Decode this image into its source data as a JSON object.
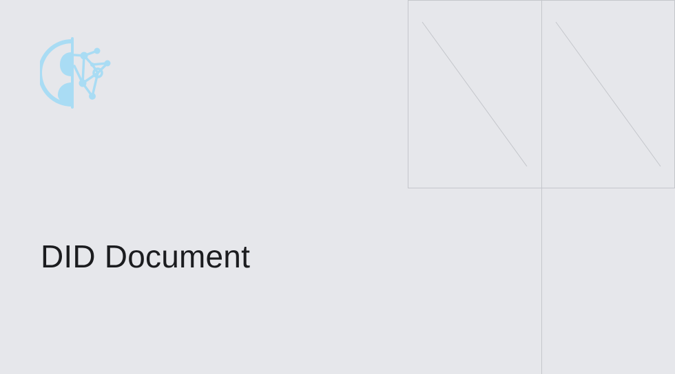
{
  "page": {
    "title": "DID Document"
  },
  "logo": {
    "icon": "did-network-brain-icon",
    "color": "#a9dcf4"
  },
  "colors": {
    "background": "#e6e7eb",
    "title": "#1b1c1f",
    "lines": "#c4c6cb"
  }
}
